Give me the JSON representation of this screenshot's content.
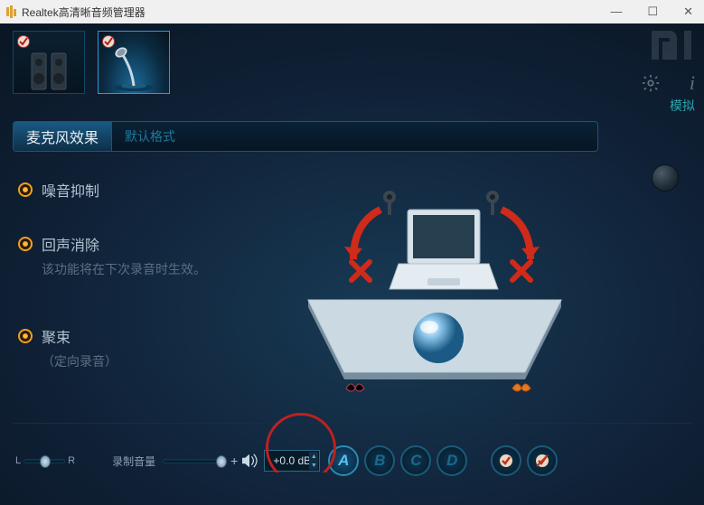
{
  "window": {
    "title": "Realtek高清晰音频管理器"
  },
  "sidebar_right": {
    "mode_label": "模拟"
  },
  "tabs": [
    {
      "label": "麦克风效果",
      "active": true
    },
    {
      "label": "默认格式",
      "active": false
    }
  ],
  "options": {
    "noise_suppression": {
      "label": "噪音抑制",
      "checked": true
    },
    "echo_cancel": {
      "label": "回声消除",
      "sub": "该功能将在下次录音时生效。",
      "checked": true
    },
    "beam_forming": {
      "label": "聚束",
      "sub": "（定向录音）",
      "checked": true
    }
  },
  "bottom": {
    "balance_left": "L",
    "balance_right": "R",
    "rec_volume_label": "录制音量",
    "gain_db": "+0.0 dB",
    "presets": [
      "A",
      "B",
      "C",
      "D"
    ]
  }
}
